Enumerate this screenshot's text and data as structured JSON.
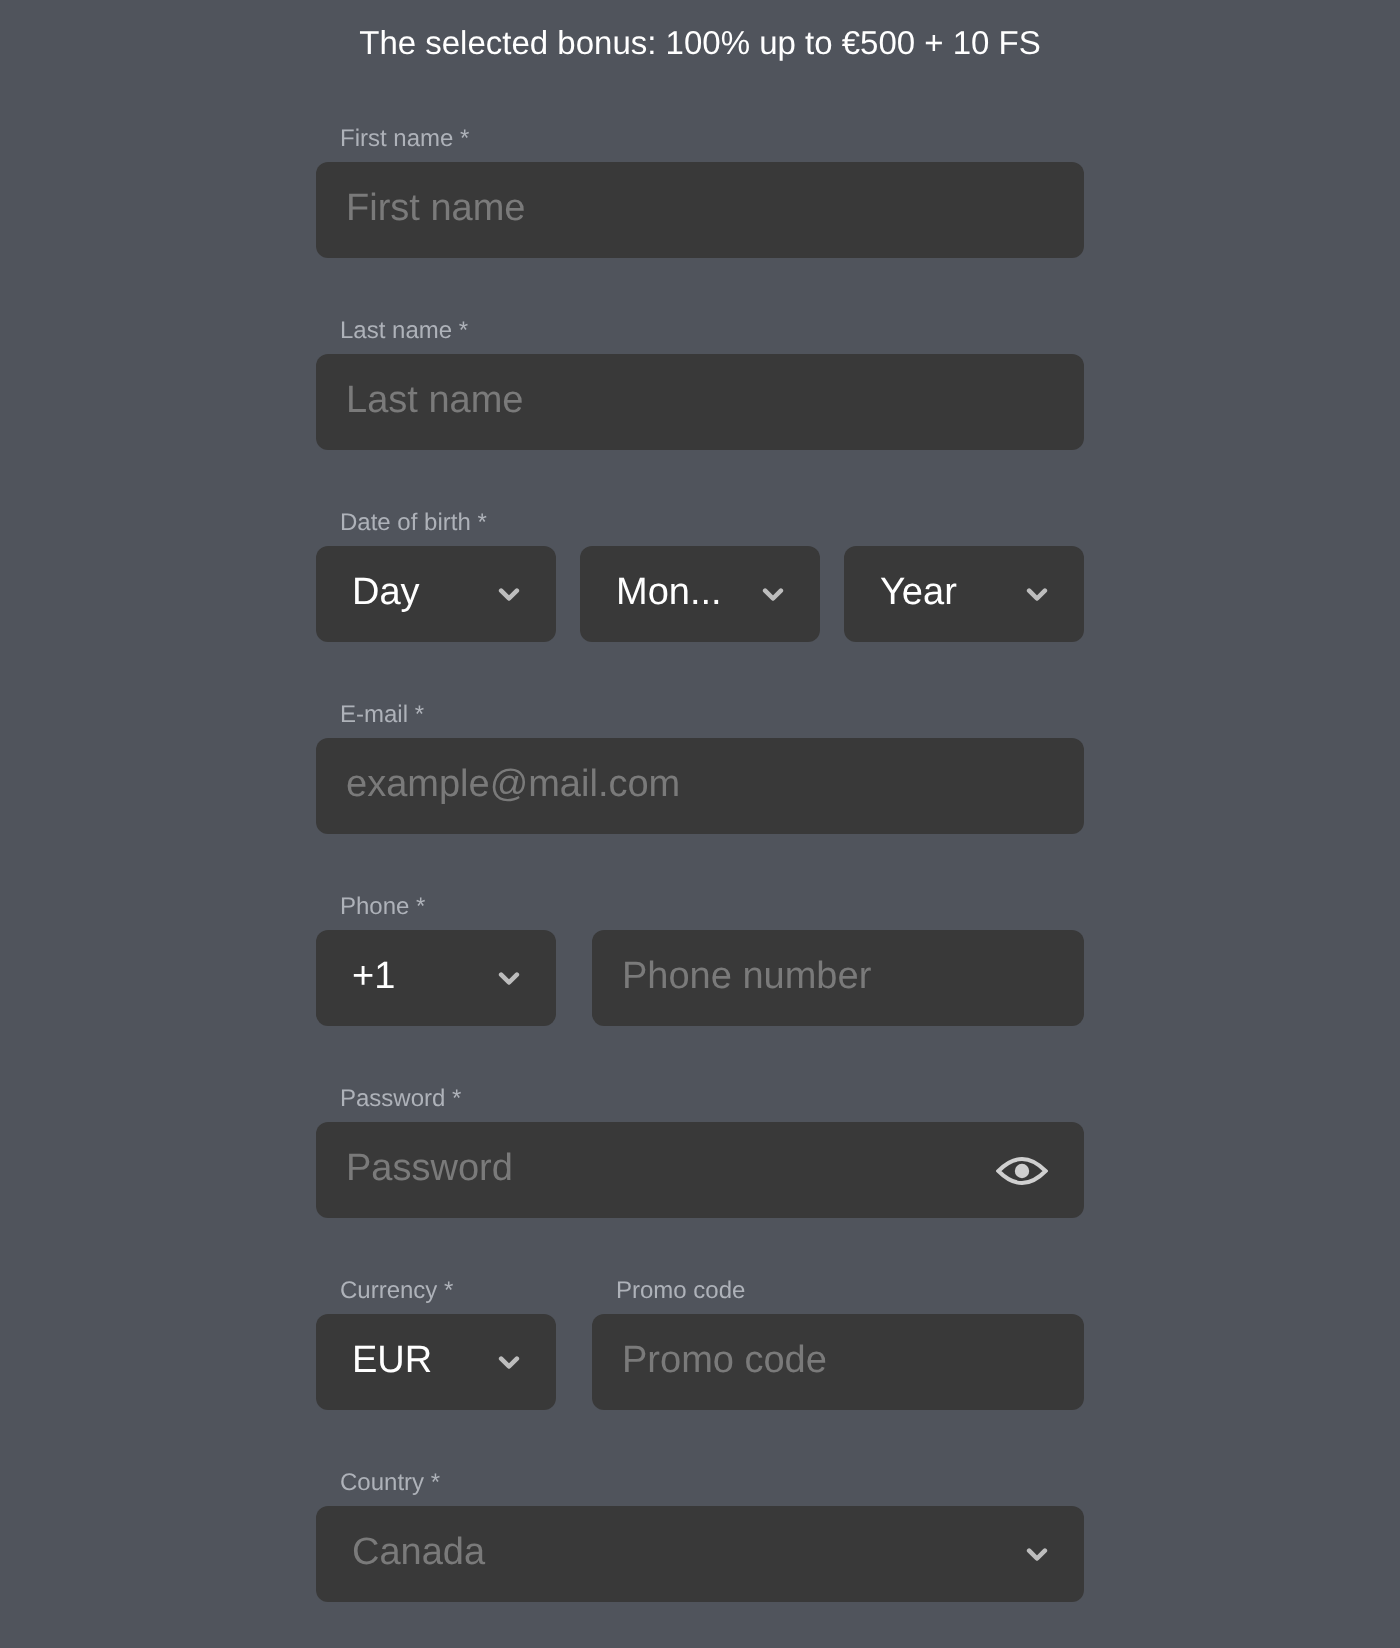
{
  "title": "The selected bonus: 100% up to €500 + 10 FS",
  "rows": [
    {
      "label": "First name *",
      "fields": [
        {
          "kind": "input",
          "placeholder": "First name"
        }
      ]
    },
    {
      "label": "Last name *",
      "fields": [
        {
          "kind": "input",
          "placeholder": "Last name"
        }
      ]
    },
    {
      "label": "Date of birth *",
      "fields": [
        {
          "kind": "select",
          "value": "Day",
          "disabled": false
        },
        {
          "kind": "select",
          "value": "Mon...",
          "disabled": false
        },
        {
          "kind": "select",
          "value": "Year",
          "disabled": false
        }
      ]
    },
    {
      "label": "E-mail *",
      "fields": [
        {
          "kind": "input",
          "placeholder": "example@mail.com"
        }
      ]
    },
    {
      "label": "Phone *",
      "fields": [
        {
          "kind": "select",
          "value": "+1",
          "disabled": false
        },
        {
          "kind": "input",
          "placeholder": "Phone number"
        }
      ]
    },
    {
      "label": "Password *",
      "fields": [
        {
          "kind": "password",
          "placeholder": "Password"
        }
      ]
    },
    {
      "fields": [
        {
          "kind": "select",
          "label": "Currency *",
          "value": "EUR",
          "disabled": false
        },
        {
          "kind": "input",
          "label": "Promo code",
          "placeholder": "Promo code"
        }
      ]
    },
    {
      "label": "Country *",
      "fields": [
        {
          "kind": "select",
          "value": "Canada",
          "disabled": true
        }
      ]
    }
  ]
}
